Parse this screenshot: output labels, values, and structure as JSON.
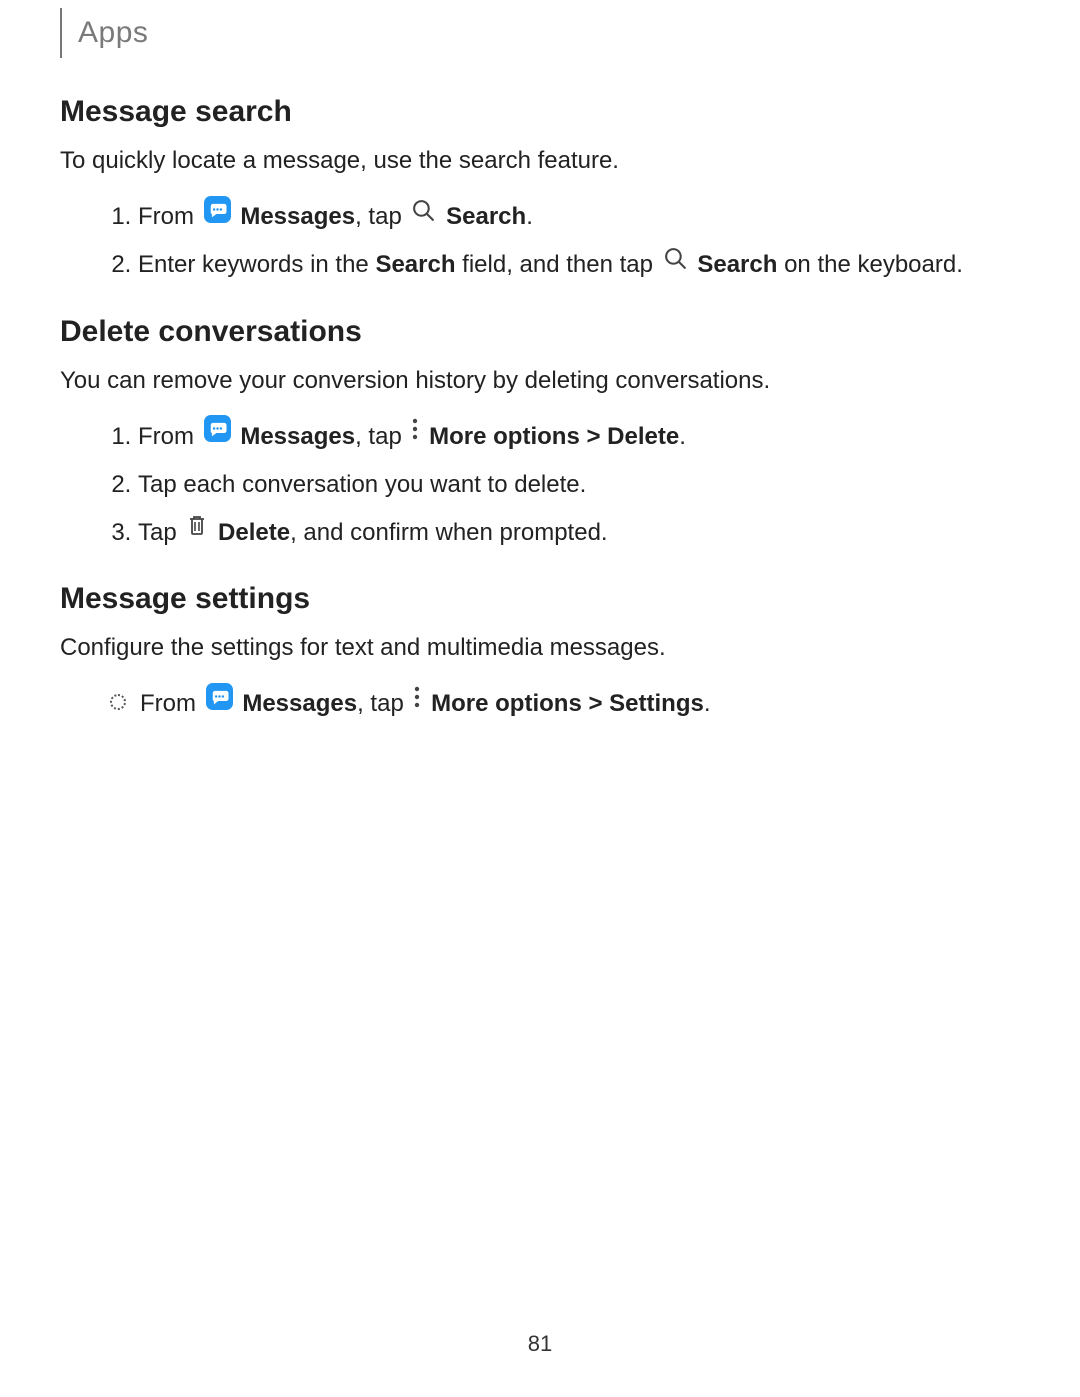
{
  "header": {
    "section": "Apps"
  },
  "page_number": "81",
  "sections": [
    {
      "heading": "Message search",
      "intro": "To quickly locate a message, use the search feature.",
      "list_type": "ol",
      "items": [
        {
          "pre1": "From ",
          "icon1": "messages",
          "bold1": "Messages",
          "mid": ", tap ",
          "icon2": "search",
          "bold2": "Search",
          "post": "."
        },
        {
          "pre1": "Enter keywords in the ",
          "bold1": "Search",
          "mid": " field, and then tap ",
          "icon2": "search",
          "bold2": "Search",
          "post": " on the keyboard."
        }
      ]
    },
    {
      "heading": "Delete conversations",
      "intro": "You can remove your conversion history by deleting conversations.",
      "list_type": "ol",
      "items": [
        {
          "pre1": "From ",
          "icon1": "messages",
          "bold1": "Messages",
          "mid": ", tap ",
          "icon2": "more",
          "bold2": "More options > Delete",
          "post": "."
        },
        {
          "pre1": "Tap each conversation you want to delete."
        },
        {
          "pre1": "Tap ",
          "icon1": "trash",
          "bold1": "Delete",
          "mid": ", and confirm when prompted."
        }
      ]
    },
    {
      "heading": "Message settings",
      "intro": "Configure the settings for text and multimedia messages.",
      "list_type": "ul",
      "items": [
        {
          "pre1": "From ",
          "icon1": "messages",
          "bold1": "Messages",
          "mid": ", tap ",
          "icon2": "more",
          "bold2": "More options > Settings",
          "post": "."
        }
      ]
    }
  ]
}
